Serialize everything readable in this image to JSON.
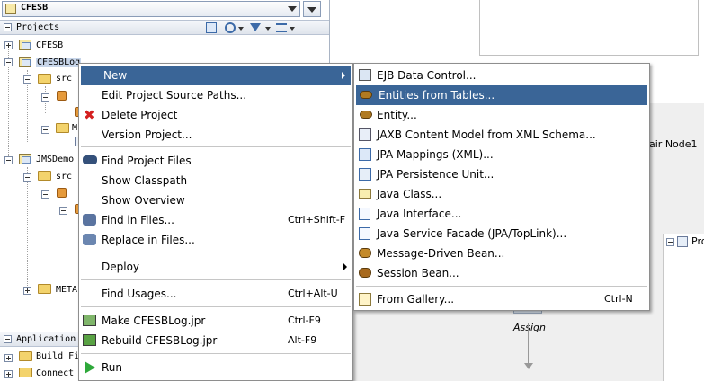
{
  "app_combo": {
    "value": "CFESB"
  },
  "projects_panel": {
    "title": "Projects"
  },
  "tree": {
    "cfesb": "CFESB",
    "cfesblog": "CFESBLog",
    "src1": "src",
    "m_folder": "M",
    "jmsdemo": "JMSDemo",
    "src2": "src",
    "meta": "META",
    "application": "Application",
    "build": "Build Fi",
    "connect": "Connect"
  },
  "canvas": {
    "node_label": "air Node1",
    "pr_label": "Pro",
    "assign_label": "Assign"
  },
  "context_menu": {
    "items": [
      {
        "label": "New",
        "accel": ""
      },
      {
        "label": "Edit Project Source Paths...",
        "accel": ""
      },
      {
        "label": "Delete Project",
        "accel": ""
      },
      {
        "label": "Version Project...",
        "accel": ""
      },
      {
        "label": "Find Project Files",
        "accel": ""
      },
      {
        "label": "Show Classpath",
        "accel": ""
      },
      {
        "label": "Show Overview",
        "accel": ""
      },
      {
        "label": "Find in Files...",
        "accel": "Ctrl+Shift-F"
      },
      {
        "label": "Replace in Files...",
        "accel": ""
      },
      {
        "label": "Deploy",
        "accel": ""
      },
      {
        "label": "Find Usages...",
        "accel": "Ctrl+Alt-U"
      },
      {
        "label": "Make CFESBLog.jpr",
        "accel": "Ctrl-F9"
      },
      {
        "label": "Rebuild CFESBLog.jpr",
        "accel": "Alt-F9"
      },
      {
        "label": "Run",
        "accel": ""
      }
    ]
  },
  "sub_menu": {
    "items": [
      {
        "label": "EJB Data Control...",
        "accel": ""
      },
      {
        "label": "Entities from Tables...",
        "accel": ""
      },
      {
        "label": "Entity...",
        "accel": ""
      },
      {
        "label": "JAXB Content Model from XML Schema...",
        "accel": ""
      },
      {
        "label": "JPA Mappings (XML)...",
        "accel": ""
      },
      {
        "label": "JPA Persistence Unit...",
        "accel": ""
      },
      {
        "label": "Java Class...",
        "accel": ""
      },
      {
        "label": "Java Interface...",
        "accel": ""
      },
      {
        "label": "Java Service Facade (JPA/TopLink)...",
        "accel": ""
      },
      {
        "label": "Message-Driven Bean...",
        "accel": ""
      },
      {
        "label": "Session Bean...",
        "accel": ""
      },
      {
        "label": "From Gallery...",
        "accel": "Ctrl-N"
      }
    ]
  },
  "colors": {
    "selection": "#3a6597",
    "menu_border": "#8e8e8e"
  }
}
